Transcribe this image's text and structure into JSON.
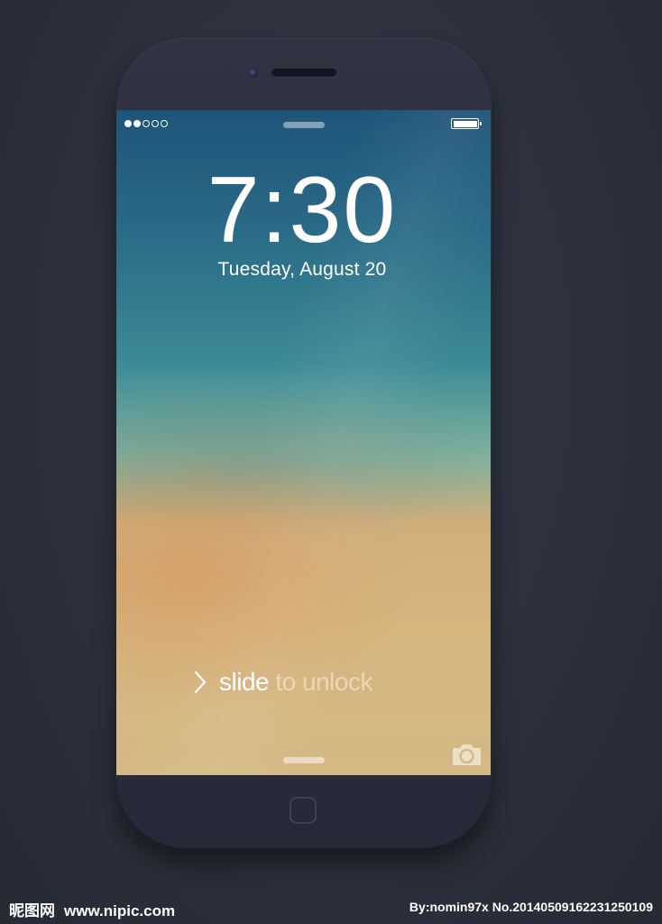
{
  "lockscreen": {
    "time": "7:30",
    "date": "Tuesday, August 20",
    "unlock": {
      "highlight": "slide",
      "rest": " to unlock",
      "chevron_icon": "chevron-right-icon"
    },
    "status_bar": {
      "signal_dots_filled": 2,
      "signal_dots_total": 5,
      "battery_level": 1.0
    },
    "camera_icon": "camera-icon"
  },
  "watermark": {
    "brand": "昵图网",
    "site": "www.nipic.com",
    "credit": "By:nomin97x  No.20140509162231250109"
  },
  "colors": {
    "background": "#2d303c",
    "phone_body": "#2a2d3b",
    "screen_top": "#1f5479",
    "screen_mid": "#3b8a96",
    "screen_bottom": "#d4b985",
    "text": "#ffffff"
  }
}
